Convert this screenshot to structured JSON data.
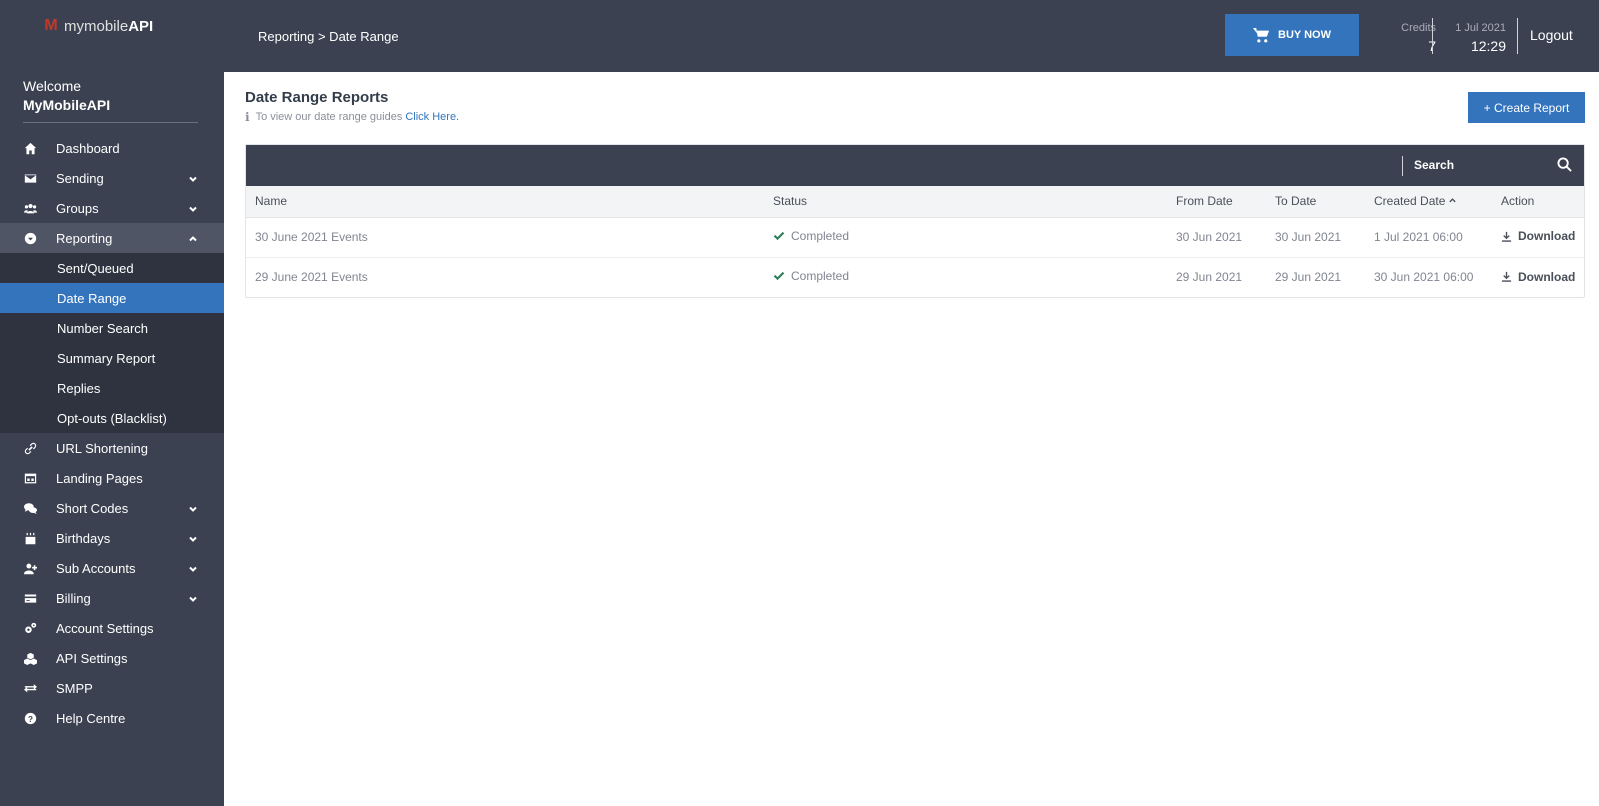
{
  "brand": {
    "prefix": "mymobile",
    "suffix": "API",
    "mark": "M"
  },
  "welcome": {
    "greeting": "Welcome",
    "user": "MyMobileAPI"
  },
  "sidebar": {
    "items": [
      {
        "label": "Dashboard",
        "icon": "home-icon"
      },
      {
        "label": "Sending",
        "icon": "envelope-icon"
      },
      {
        "label": "Groups",
        "icon": "users-icon"
      },
      {
        "label": "Reporting",
        "icon": "reporting-icon"
      },
      {
        "label": "URL Shortening",
        "icon": "link-icon"
      },
      {
        "label": "Landing Pages",
        "icon": "landing-page-icon"
      },
      {
        "label": "Short Codes",
        "icon": "comments-icon"
      },
      {
        "label": "Birthdays",
        "icon": "cake-icon"
      },
      {
        "label": "Sub Accounts",
        "icon": "user-plus-icon"
      },
      {
        "label": "Billing",
        "icon": "credit-card-icon"
      },
      {
        "label": "Account Settings",
        "icon": "cogs-icon"
      },
      {
        "label": "API Settings",
        "icon": "cubes-icon"
      },
      {
        "label": "SMPP",
        "icon": "exchange-icon"
      },
      {
        "label": "Help Centre",
        "icon": "question-icon"
      }
    ],
    "reporting_sub": [
      {
        "label": "Sent/Queued"
      },
      {
        "label": "Date Range"
      },
      {
        "label": "Number Search"
      },
      {
        "label": "Summary Report"
      },
      {
        "label": "Replies"
      },
      {
        "label": "Opt-outs (Blacklist)"
      }
    ]
  },
  "header": {
    "breadcrumb": "Reporting > Date Range",
    "buy_label": "BUY NOW",
    "credits_label": "Credits",
    "credits_value": "7",
    "date": "1 Jul 2021",
    "time": "12:29",
    "logout": "Logout"
  },
  "page": {
    "title": "Date Range Reports",
    "guide_text": "To view our date range guides",
    "guide_link": "Click Here.",
    "create_label": "+ Create Report",
    "search_placeholder": "Search"
  },
  "table": {
    "columns": [
      "Name",
      "Status",
      "From Date",
      "To Date",
      "Created Date",
      "Action"
    ],
    "rows": [
      {
        "name": "30 June 2021 Events",
        "status": "Completed",
        "from": "30 Jun 2021",
        "to": "30 Jun 2021",
        "created": "1 Jul 2021 06:00",
        "action": "Download"
      },
      {
        "name": "29 June 2021 Events",
        "status": "Completed",
        "from": "29 Jun 2021",
        "to": "29 Jun 2021",
        "created": "30 Jun 2021 06:00",
        "action": "Download"
      }
    ]
  },
  "colors": {
    "sidebar": "#3b4150",
    "accent": "#3374bd",
    "success": "#2e7d5b"
  }
}
